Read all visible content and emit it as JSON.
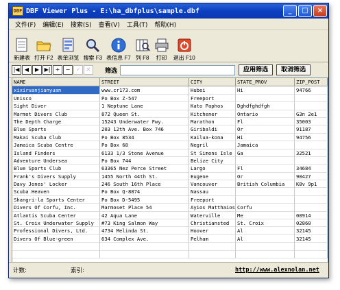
{
  "window": {
    "title": "DBF Viewer Plus - E:\\ha_dbfplus\\sample.dbf",
    "icon": "dbf-app-icon"
  },
  "controls": {
    "minimize": "_",
    "maximize": "□",
    "close": "×"
  },
  "menu": [
    {
      "label": "文件(F)"
    },
    {
      "label": "编辑(E)"
    },
    {
      "label": "搜索(S)"
    },
    {
      "label": "查看(V)"
    },
    {
      "label": "工具(T)"
    },
    {
      "label": "帮助(H)"
    }
  ],
  "toolbar": [
    {
      "label": "新建表",
      "icon": "new-table-icon"
    },
    {
      "label": "打开 F2",
      "icon": "open-folder-icon"
    },
    {
      "label": "表单浏览",
      "icon": "form-browse-icon"
    },
    {
      "label": "搜索 F3",
      "icon": "search-icon"
    },
    {
      "label": "表信息 F7",
      "icon": "info-icon"
    },
    {
      "label": "列 F8",
      "icon": "columns-icon"
    },
    {
      "label": "打印",
      "icon": "printer-icon"
    },
    {
      "label": "退出 F10",
      "icon": "exit-icon"
    }
  ],
  "navigation": {
    "buttons": [
      "|◀",
      "◀",
      "▶",
      "▶|",
      "+",
      "−",
      "✓",
      "✕"
    ],
    "filter_label": "筛选",
    "filter_value": "",
    "apply_filter": "应用筛选",
    "cancel_filter": "取消筛选"
  },
  "table": {
    "columns": [
      "NAME",
      "STREET",
      "CITY",
      "STATE_PROV",
      "ZIP_POST"
    ],
    "rows": [
      [
        "xixiruanjianyuan",
        "www.cr173.com",
        "Hubei",
        "Hi",
        "94766"
      ],
      [
        "Unisco",
        "Po Box Z-547",
        "Freeport",
        "",
        ""
      ],
      [
        "Sight Diver",
        "1 Neptune Lane",
        "Kato Paphos",
        "Dghdfghdfgh",
        ""
      ],
      [
        "Marmot Divers Club",
        "872 Queen St.",
        "Kitchener",
        "Ontario",
        "G3n 2e1"
      ],
      [
        "The Depth Charge",
        "15243 Underwater Fwy.",
        "Marathon",
        "Fl",
        "35003"
      ],
      [
        "Blue Sports",
        "203 12th Ave. Box 746",
        "Giribaldi",
        "Or",
        "91187"
      ],
      [
        "Makai Scuba Club",
        "Po Box 8534",
        "Kailua-kona",
        "Hi",
        "94756"
      ],
      [
        "Jamaica Scuba Centre",
        "Po Box 68",
        "Negril",
        "Jamaica",
        ""
      ],
      [
        "Island Finders",
        "6133 1/3 Stone Avenue",
        "St Simons Isle",
        "Ga",
        "32521"
      ],
      [
        "Adventure Undersea",
        "Po Box 744",
        "Belize City",
        "",
        ""
      ],
      [
        "Blue Sports Club",
        "63365 Nez Perce Street",
        "Largo",
        "Fl",
        "34684"
      ],
      [
        "Frank's Divers Supply",
        "1455 North 44th St.",
        "Eugene",
        "Or",
        "90427"
      ],
      [
        "Davy Jones' Locker",
        "246 South 16th Place",
        "Vancouver",
        "British Columbia",
        "K8v 9p1"
      ],
      [
        "Scuba Heaven",
        "Po Box Q-8874",
        "Nassau",
        "",
        ""
      ],
      [
        "Shangri-la Sports Center",
        "Po Box D-5495",
        "Freeport",
        "",
        ""
      ],
      [
        "Divers Of Corfu, Inc.",
        "Marmoset Place 54",
        "Ayios Matthaios",
        "Corfu",
        ""
      ],
      [
        "Atlantis Scuba Center",
        "42 Aqua Lane",
        "Waterville",
        "Me",
        "00914"
      ],
      [
        "St. Croix Underwater Supply",
        "#73 King Salmon Way",
        "Christiansted",
        "St. Croix",
        "02860"
      ],
      [
        "Professional Divers, Ltd.",
        "4734 Melinda St.",
        "Hoover",
        "Al",
        "32145"
      ],
      [
        "Divers Of Blue-green",
        "634 Complex Ave.",
        "Pelham",
        "Al",
        "32145"
      ],
      [
        "",
        "",
        "",
        "",
        ""
      ],
      [
        "",
        "",
        "",
        "",
        ""
      ]
    ]
  },
  "status": {
    "count_label": "计数:",
    "index_label": "索引:",
    "url": "http://www.alexnolan.net"
  }
}
